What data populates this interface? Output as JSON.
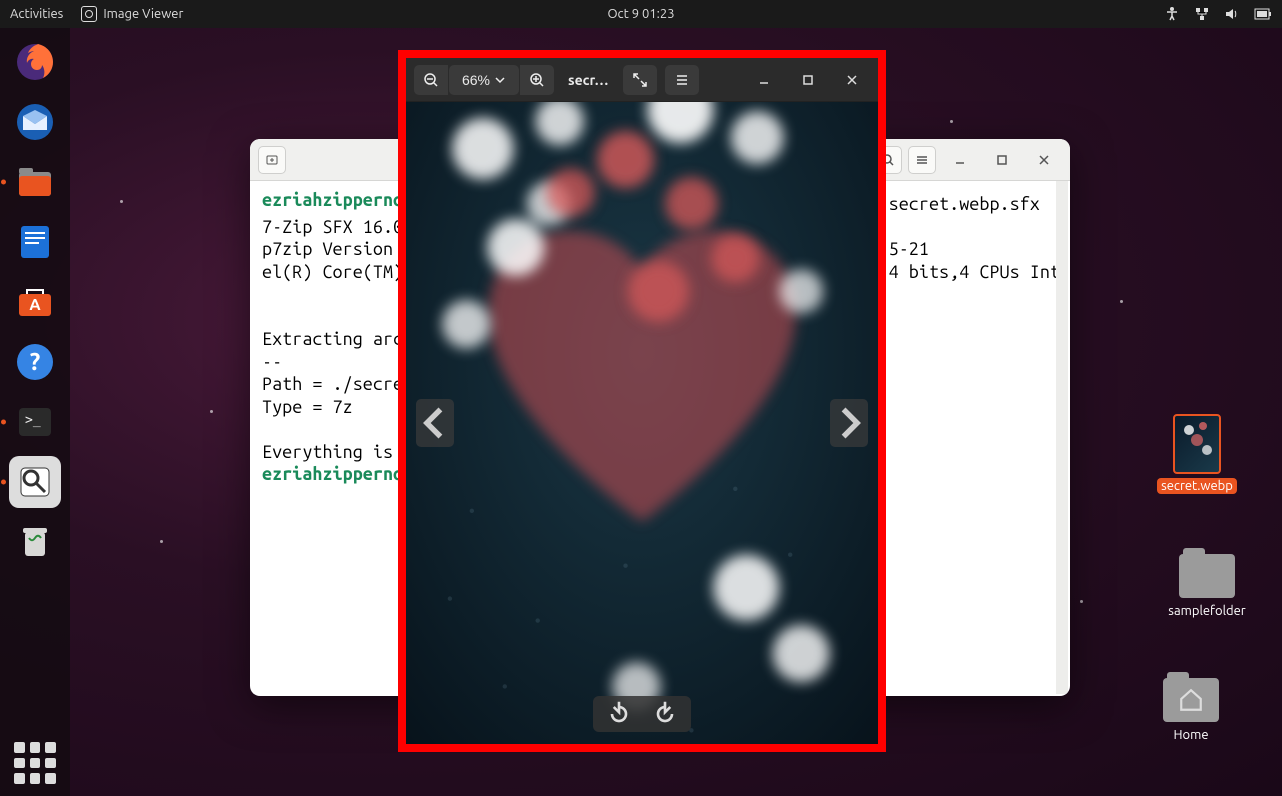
{
  "topbar": {
    "activities": "Activities",
    "app_name": "Image Viewer",
    "datetime": "Oct 9  01:23"
  },
  "terminal": {
    "title": "",
    "prompt_user": "ezriahzippernows",
    "lines_before_viewer": "7-Zip SFX 16.0\np7zip Version \nel(R) Core(TM) \n\n\nExtracting archi\n--\nPath = ./secret\nType = 7z\n\nEverything is O",
    "lines_after_viewer": "secret.webp.sfx\n\n5-21\n4 bits,4 CPUs Int"
  },
  "viewer": {
    "zoom": "66%",
    "filename_short": "secr…"
  },
  "desktop": {
    "file1": "secret.webp",
    "folder1": "samplefolder",
    "home": "Home"
  }
}
